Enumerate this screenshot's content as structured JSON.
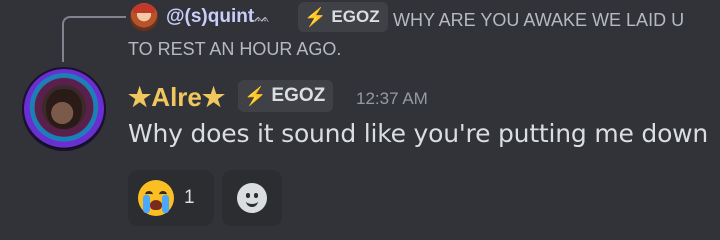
{
  "reply": {
    "author": "@(s)quint",
    "badge_icon": "ᨐ",
    "tag": "EGOZ",
    "text": "WHY ARE YOU AWAKE WE LAID U TO REST AN HOUR AGO."
  },
  "message": {
    "author": "★Alre★",
    "tag": "EGOZ",
    "timestamp": "12:37 AM",
    "text": "Why does it sound like you're putting me down"
  },
  "reactions": [
    {
      "emoji": "crying-face",
      "count": "1"
    }
  ],
  "colors": {
    "background": "#313338",
    "username": "#f0c75e",
    "reply_name": "#c9cdfb",
    "tag_bg": "#3f4147",
    "bolt": "#a78bfa"
  },
  "icons": {
    "tag_icon": "⚡",
    "add_reaction": "smile-icon"
  }
}
